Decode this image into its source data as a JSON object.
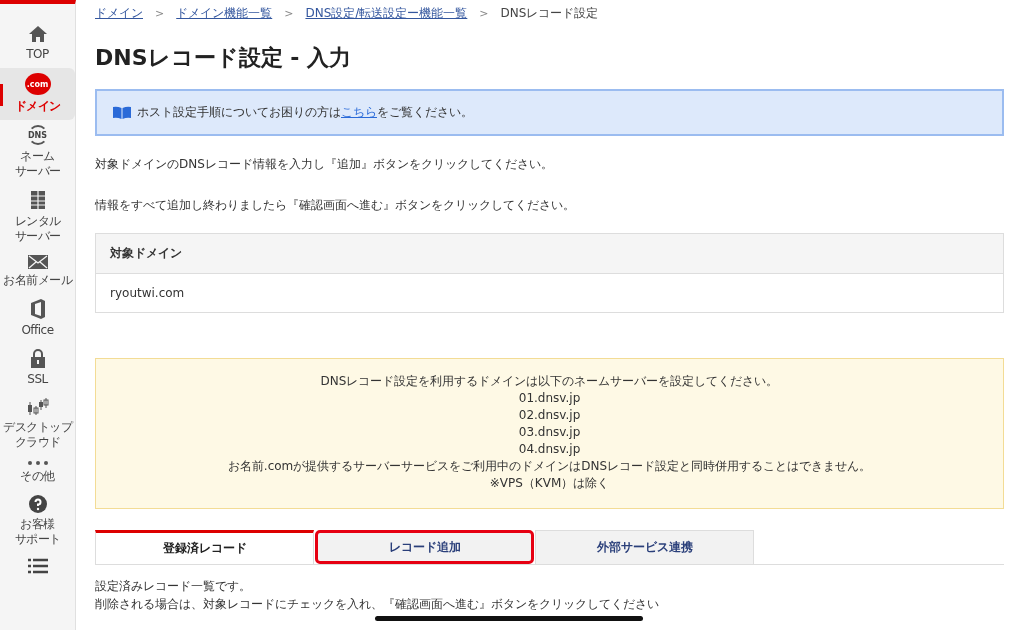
{
  "sidebar": {
    "items": [
      {
        "kind": "home",
        "label": [
          "TOP"
        ],
        "selected": false
      },
      {
        "kind": "com",
        "icon_text": ".com",
        "label": [
          "ドメイン"
        ],
        "selected": true
      },
      {
        "kind": "dns",
        "icon_text": "DNS",
        "label": [
          "ネーム",
          "サーバー"
        ],
        "selected": false
      },
      {
        "kind": "server",
        "label": [
          "レンタル",
          "サーバー"
        ],
        "selected": false
      },
      {
        "kind": "mail",
        "label": [
          "お名前メール"
        ],
        "selected": false
      },
      {
        "kind": "office",
        "label": [
          "Office"
        ],
        "selected": false
      },
      {
        "kind": "lock",
        "label": [
          "SSL"
        ],
        "selected": false
      },
      {
        "kind": "chart",
        "label": [
          "デスクトップ",
          "クラウド"
        ],
        "selected": false
      },
      {
        "kind": "dots",
        "label": [
          "その他"
        ],
        "selected": false
      },
      {
        "kind": "help",
        "label": [
          "お客様",
          "サポート"
        ],
        "selected": false
      },
      {
        "kind": "list",
        "selected": false
      }
    ]
  },
  "breadcrumb": [
    {
      "label": "ドメイン",
      "link": true
    },
    {
      "separator": ">"
    },
    {
      "label": "ドメイン機能一覧",
      "link": true
    },
    {
      "separator": ">"
    },
    {
      "label": "DNS設定/転送設定ー機能一覧",
      "link": true
    },
    {
      "separator": ">"
    },
    {
      "label": "DNSレコード設定",
      "link": false
    }
  ],
  "title": "DNSレコード設定 - 入力",
  "info": {
    "before": "ホスト設定手順についてお困りの方は",
    "link": "こちら",
    "after": "をご覧ください。"
  },
  "instructions": [
    "対象ドメインのDNSレコード情報を入力し『追加』ボタンをクリックしてください。",
    "情報をすべて追加し終わりましたら『確認画面へ進む』ボタンをクリックしてください。"
  ],
  "domain_table": {
    "header": "対象ドメイン",
    "value": "ryoutwi.com"
  },
  "notice": [
    "DNSレコード設定を利用するドメインは以下のネームサーバーを設定してください。",
    "01.dnsv.jp",
    "02.dnsv.jp",
    "03.dnsv.jp",
    "04.dnsv.jp",
    "お名前.comが提供するサーバーサービスをご利用中のドメインはDNSレコード設定と同時併用することはできません。",
    "※VPS（KVM）は除く"
  ],
  "tabs": [
    {
      "label": "登録済レコード",
      "selected": true,
      "highlighted": false
    },
    {
      "label": "レコード追加",
      "selected": false,
      "highlighted": true
    },
    {
      "label": "外部サービス連携",
      "selected": false,
      "highlighted": false
    }
  ],
  "tab_text": [
    "設定済みレコード一覧です。",
    "削除される場合は、対象レコードにチェックを入れ、『確認画面へ進む』ボタンをクリックしてください"
  ]
}
